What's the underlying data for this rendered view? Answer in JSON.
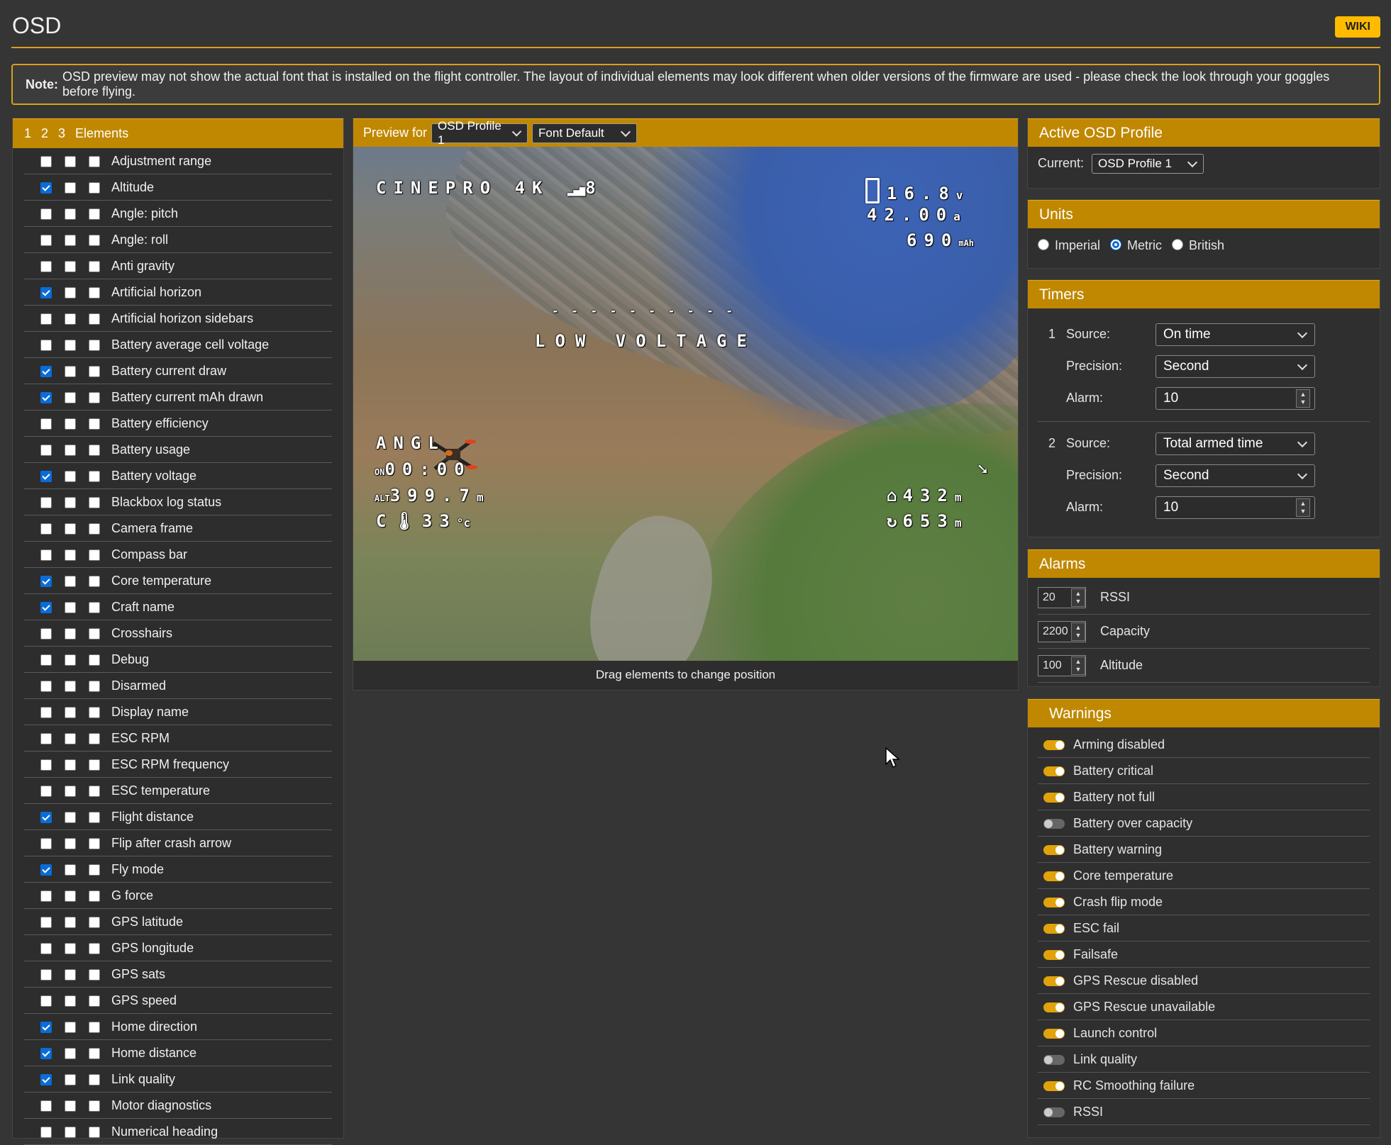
{
  "page": {
    "title": "OSD",
    "wiki_label": "WIKI",
    "note_label": "Note:",
    "note_text": "OSD preview may not show the actual font that is installed on the flight controller. The layout of individual elements may look different when older versions of the firmware are used - please check the look through your goggles before flying."
  },
  "elements_panel": {
    "header_tabs": [
      "1",
      "2",
      "3",
      "Elements"
    ],
    "items": [
      {
        "label": "Adjustment range",
        "checked": [
          false,
          false,
          false
        ]
      },
      {
        "label": "Altitude",
        "checked": [
          true,
          false,
          false
        ]
      },
      {
        "label": "Angle: pitch",
        "checked": [
          false,
          false,
          false
        ]
      },
      {
        "label": "Angle: roll",
        "checked": [
          false,
          false,
          false
        ]
      },
      {
        "label": "Anti gravity",
        "checked": [
          false,
          false,
          false
        ]
      },
      {
        "label": "Artificial horizon",
        "checked": [
          true,
          false,
          false
        ]
      },
      {
        "label": "Artificial horizon sidebars",
        "checked": [
          false,
          false,
          false
        ]
      },
      {
        "label": "Battery average cell voltage",
        "checked": [
          false,
          false,
          false
        ]
      },
      {
        "label": "Battery current draw",
        "checked": [
          true,
          false,
          false
        ]
      },
      {
        "label": "Battery current mAh drawn",
        "checked": [
          true,
          false,
          false
        ]
      },
      {
        "label": "Battery efficiency",
        "checked": [
          false,
          false,
          false
        ]
      },
      {
        "label": "Battery usage",
        "checked": [
          false,
          false,
          false
        ]
      },
      {
        "label": "Battery voltage",
        "checked": [
          true,
          false,
          false
        ]
      },
      {
        "label": "Blackbox log status",
        "checked": [
          false,
          false,
          false
        ]
      },
      {
        "label": "Camera frame",
        "checked": [
          false,
          false,
          false
        ]
      },
      {
        "label": "Compass bar",
        "checked": [
          false,
          false,
          false
        ]
      },
      {
        "label": "Core temperature",
        "checked": [
          true,
          false,
          false
        ]
      },
      {
        "label": "Craft name",
        "checked": [
          true,
          false,
          false
        ]
      },
      {
        "label": "Crosshairs",
        "checked": [
          false,
          false,
          false
        ]
      },
      {
        "label": "Debug",
        "checked": [
          false,
          false,
          false
        ]
      },
      {
        "label": "Disarmed",
        "checked": [
          false,
          false,
          false
        ]
      },
      {
        "label": "Display name",
        "checked": [
          false,
          false,
          false
        ]
      },
      {
        "label": "ESC RPM",
        "checked": [
          false,
          false,
          false
        ]
      },
      {
        "label": "ESC RPM frequency",
        "checked": [
          false,
          false,
          false
        ]
      },
      {
        "label": "ESC temperature",
        "checked": [
          false,
          false,
          false
        ]
      },
      {
        "label": "Flight distance",
        "checked": [
          true,
          false,
          false
        ]
      },
      {
        "label": "Flip after crash arrow",
        "checked": [
          false,
          false,
          false
        ]
      },
      {
        "label": "Fly mode",
        "checked": [
          true,
          false,
          false
        ]
      },
      {
        "label": "G force",
        "checked": [
          false,
          false,
          false
        ]
      },
      {
        "label": "GPS latitude",
        "checked": [
          false,
          false,
          false
        ]
      },
      {
        "label": "GPS longitude",
        "checked": [
          false,
          false,
          false
        ]
      },
      {
        "label": "GPS sats",
        "checked": [
          false,
          false,
          false
        ]
      },
      {
        "label": "GPS speed",
        "checked": [
          false,
          false,
          false
        ]
      },
      {
        "label": "Home direction",
        "checked": [
          true,
          false,
          false
        ]
      },
      {
        "label": "Home distance",
        "checked": [
          true,
          false,
          false
        ]
      },
      {
        "label": "Link quality",
        "checked": [
          true,
          false,
          false
        ]
      },
      {
        "label": "Motor diagnostics",
        "checked": [
          false,
          false,
          false
        ]
      },
      {
        "label": "Numerical heading",
        "checked": [
          false,
          false,
          false
        ]
      }
    ]
  },
  "preview": {
    "preview_for_label": "Preview for",
    "profile_select": "OSD Profile 1",
    "font_select": "Font Default",
    "caption": "Drag elements to change position",
    "osd": {
      "craft_name": "CINEPRO 4K",
      "link_quality": "8",
      "voltage": "16.8",
      "voltage_unit": "v",
      "current": "42.00",
      "current_unit": "a",
      "mah": "690",
      "horizon": "- - - - - - - - - -",
      "warning": "LOW VOLTAGE",
      "fly_mode": "ANGL",
      "timer": "00:00",
      "altitude": "399.7",
      "altitude_unit": "m",
      "temperature": "33",
      "temperature_unit": "°c",
      "home_distance": "432",
      "flight_distance": "653",
      "distance_unit": "m"
    }
  },
  "active_profile": {
    "title": "Active OSD Profile",
    "current_label": "Current:",
    "current_value": "OSD Profile 1"
  },
  "units": {
    "title": "Units",
    "options": [
      "Imperial",
      "Metric",
      "British"
    ],
    "selected": "Metric"
  },
  "timers": {
    "title": "Timers",
    "source_label": "Source:",
    "precision_label": "Precision:",
    "alarm_label": "Alarm:",
    "items": [
      {
        "number": "1",
        "source": "On time",
        "precision": "Second",
        "alarm": "10"
      },
      {
        "number": "2",
        "source": "Total armed time",
        "precision": "Second",
        "alarm": "10"
      }
    ]
  },
  "alarms": {
    "title": "Alarms",
    "items": [
      {
        "value": "20",
        "label": "RSSI"
      },
      {
        "value": "2200",
        "label": "Capacity"
      },
      {
        "value": "100",
        "label": "Altitude"
      }
    ]
  },
  "warnings": {
    "title": "Warnings",
    "items": [
      {
        "label": "Arming disabled",
        "enabled": true
      },
      {
        "label": "Battery critical",
        "enabled": true
      },
      {
        "label": "Battery not full",
        "enabled": true
      },
      {
        "label": "Battery over capacity",
        "enabled": false
      },
      {
        "label": "Battery warning",
        "enabled": true
      },
      {
        "label": "Core temperature",
        "enabled": true
      },
      {
        "label": "Crash flip mode",
        "enabled": true
      },
      {
        "label": "ESC fail",
        "enabled": true
      },
      {
        "label": "Failsafe",
        "enabled": true
      },
      {
        "label": "GPS Rescue disabled",
        "enabled": true
      },
      {
        "label": "GPS Rescue unavailable",
        "enabled": true
      },
      {
        "label": "Launch control",
        "enabled": true
      },
      {
        "label": "Link quality",
        "enabled": false
      },
      {
        "label": "RC Smoothing failure",
        "enabled": true
      },
      {
        "label": "RSSI",
        "enabled": false
      }
    ]
  },
  "colors": {
    "background": "#353535",
    "accent": "#c08800",
    "wiki": "#ffbb00",
    "checkbox_checked": "#0a6cd8"
  }
}
